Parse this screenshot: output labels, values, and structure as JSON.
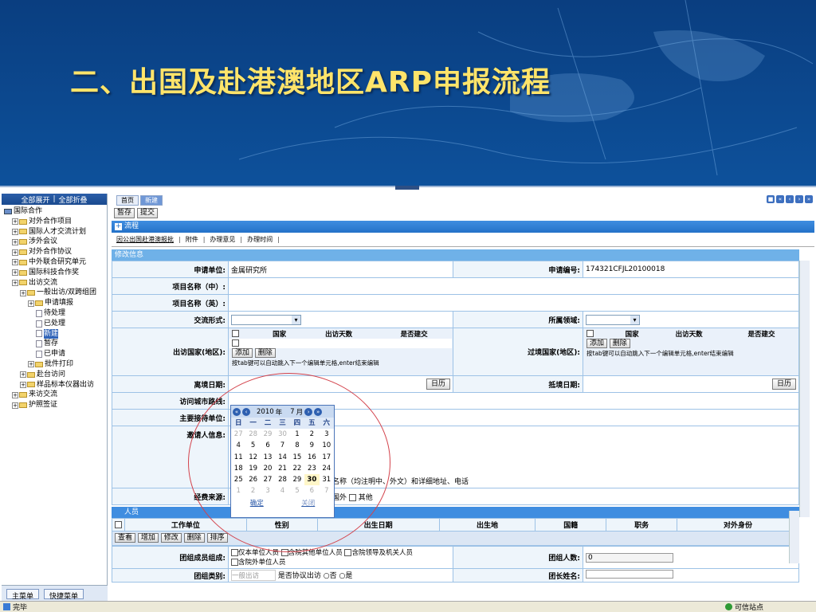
{
  "slide": {
    "title": "二、出国及赴港澳地区ARP申报流程"
  },
  "left_panel": {
    "expand_all": "全部展开",
    "collapse_all": "全部折叠",
    "tree": [
      {
        "label": "国际合作",
        "level": 0,
        "kind": "root"
      },
      {
        "label": "对外合作项目",
        "level": 1,
        "kind": "folder"
      },
      {
        "label": "国际人才交流计划",
        "level": 1,
        "kind": "folder"
      },
      {
        "label": "涉外会议",
        "level": 1,
        "kind": "folder"
      },
      {
        "label": "对外合作协议",
        "level": 1,
        "kind": "folder"
      },
      {
        "label": "中外联合研究单元",
        "level": 1,
        "kind": "folder"
      },
      {
        "label": "国际科技合作奖",
        "level": 1,
        "kind": "folder"
      },
      {
        "label": "出访交流",
        "level": 1,
        "kind": "folder"
      },
      {
        "label": "一般出访/双跨组团",
        "level": 2,
        "kind": "folder"
      },
      {
        "label": "申请填报",
        "level": 3,
        "kind": "folder"
      },
      {
        "label": "待处理",
        "level": 4,
        "kind": "doc"
      },
      {
        "label": "已处理",
        "level": 4,
        "kind": "doc"
      },
      {
        "label": "新建",
        "level": 4,
        "kind": "doc",
        "selected": true
      },
      {
        "label": "暂存",
        "level": 4,
        "kind": "doc"
      },
      {
        "label": "已申请",
        "level": 4,
        "kind": "doc"
      },
      {
        "label": "批件打印",
        "level": 3,
        "kind": "folder"
      },
      {
        "label": "赴台访问",
        "level": 2,
        "kind": "folder"
      },
      {
        "label": "样品标本仪器出访",
        "level": 2,
        "kind": "folder"
      },
      {
        "label": "来访交流",
        "level": 1,
        "kind": "folder"
      },
      {
        "label": "护照签证",
        "level": 1,
        "kind": "folder"
      }
    ],
    "bottom_tabs": [
      "主菜单",
      "快捷菜单"
    ]
  },
  "tabs": [
    "首页",
    "新建"
  ],
  "toolbar": {
    "save_draft": "暂存",
    "submit": "提交"
  },
  "flow_bar": "流程",
  "subtabs": [
    "因公出国赴港澳报批",
    "附件",
    "办理意见",
    "办理时间"
  ],
  "section_title": "修改信息",
  "form": {
    "applicant_unit_label": "申请单位:",
    "applicant_unit_value": "金属研究所",
    "apply_no_label": "申请编号:",
    "apply_no_value": "174321CFJL20100018",
    "project_cn_label": "项目名称（中）:",
    "project_en_label": "项目名称（英）:",
    "exchange_form_label": "交流形式:",
    "field_label": "所属领域:",
    "visit_country_label": "出访国家(地区):",
    "transit_country_label": "过境国家(地区):",
    "country_cols": [
      "国家",
      "出访天数",
      "是否建交"
    ],
    "add_btn": "添加",
    "del_btn": "删除",
    "tab_hint": "按tab键可以自动跳入下一个编辑单元格,enter结束编辑",
    "depart_date_label": "离境日期:",
    "arrive_date_label": "抵境日期:",
    "calendar_btn": "日历",
    "route_label": "访问城市路线:",
    "host_label": "主要接待单位:",
    "inviter_label": "邀请人信息:",
    "inviter_hint": "名称（均注明中、外文）和详细地址、电话",
    "funding_label": "经费来源:",
    "funding_opt_abroad": "国外",
    "funding_opt_other": "其他",
    "persons_section": "人员",
    "person_cols": [
      "工作单位",
      "性别",
      "出生日期",
      "出生地",
      "国籍",
      "职务",
      "对外身份"
    ],
    "person_btns": [
      "查看",
      "增加",
      "修改",
      "删除",
      "排序"
    ],
    "group_member_label": "团组成员组成:",
    "group_opts": [
      "仅本单位人员",
      "含院其他单位人员",
      "含院领导及机关人员",
      "含院外单位人员"
    ],
    "group_count_label": "团组人数:",
    "group_count_value": "0",
    "group_type_label": "团组类别:",
    "group_type_value": "一般出访",
    "agreement_label": "是否协议出访",
    "agreement_no": "否",
    "agreement_yes": "是",
    "leader_label": "团长姓名:"
  },
  "calendar": {
    "year": "2010",
    "year_suffix": "年",
    "month": "7",
    "month_suffix": "月",
    "dow": [
      "日",
      "一",
      "二",
      "三",
      "四",
      "五",
      "六"
    ],
    "weeks": [
      [
        [
          "27",
          1
        ],
        [
          "28",
          1
        ],
        [
          "29",
          1
        ],
        [
          "30",
          1
        ],
        [
          "1",
          0
        ],
        [
          "2",
          0
        ],
        [
          "3",
          0
        ]
      ],
      [
        [
          "4",
          0
        ],
        [
          "5",
          0
        ],
        [
          "6",
          0
        ],
        [
          "7",
          0
        ],
        [
          "8",
          0
        ],
        [
          "9",
          0
        ],
        [
          "10",
          0
        ]
      ],
      [
        [
          "11",
          0
        ],
        [
          "12",
          0
        ],
        [
          "13",
          0
        ],
        [
          "14",
          0
        ],
        [
          "15",
          0
        ],
        [
          "16",
          0
        ],
        [
          "17",
          0
        ]
      ],
      [
        [
          "18",
          0
        ],
        [
          "19",
          0
        ],
        [
          "20",
          0
        ],
        [
          "21",
          0
        ],
        [
          "22",
          0
        ],
        [
          "23",
          0
        ],
        [
          "24",
          0
        ]
      ],
      [
        [
          "25",
          0
        ],
        [
          "26",
          0
        ],
        [
          "27",
          0
        ],
        [
          "28",
          0
        ],
        [
          "29",
          0
        ],
        [
          "30",
          2
        ],
        [
          "31",
          0
        ]
      ],
      [
        [
          "1",
          1
        ],
        [
          "2",
          1
        ],
        [
          "3",
          1
        ],
        [
          "4",
          1
        ],
        [
          "5",
          1
        ],
        [
          "6",
          1
        ],
        [
          "7",
          1
        ]
      ]
    ],
    "ok": "确定",
    "close": "关闭"
  },
  "status": {
    "left": "完毕",
    "right": "可信站点"
  }
}
